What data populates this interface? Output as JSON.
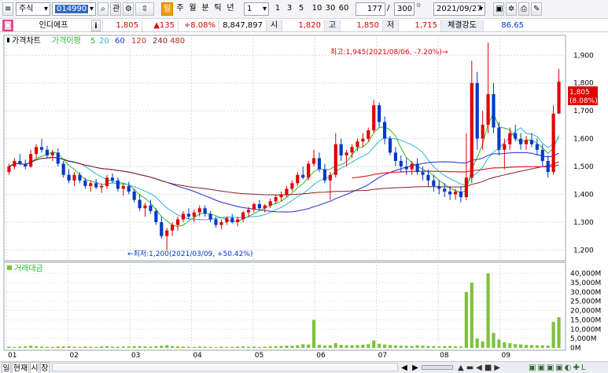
{
  "toolbar": {
    "market_select": "주식",
    "code_value": "014990",
    "buttons": {
      "gwan": "관",
      "daily": "일",
      "weekly": "주",
      "monthly": "월",
      "minute": "분",
      "tick": "틱",
      "yearly": "년",
      "period_select": "1",
      "p1": "1",
      "p3": "3",
      "p5": "5",
      "p10": "10",
      "p30": "30",
      "p60": "60"
    },
    "count_value": "177",
    "slash": "/",
    "total_value": "300",
    "date_value": "2021/09/27"
  },
  "quote": {
    "name": "인디에프",
    "info_button": "i",
    "price": "1,805",
    "change": "▲135",
    "change_pct": "+8.08%",
    "volume": "8,847,897",
    "open_label": "시",
    "open": "1,820",
    "high_label": "고",
    "high": "1,850",
    "low_label": "저",
    "low": "1,715",
    "strength_label": "체결강도",
    "strength": "86.65"
  },
  "colors": {
    "up": "#e00000",
    "down": "#0038c8",
    "ma5": "#2db82d",
    "ma20": "#2ab5d8",
    "ma60": "#1e2fd2",
    "ma120": "#e02020",
    "ma240": "#8a1e1e",
    "ma480": "#b03020",
    "volume": "#7cc23a"
  },
  "chart_data": {
    "type": "candlestick",
    "legend": {
      "price_chart": "가격차트",
      "envelope": "가격이평",
      "ma_periods": [
        "5",
        "20",
        "60",
        "120",
        "240",
        "480"
      ]
    },
    "x_ticks": [
      "01",
      "02",
      "03",
      "04",
      "05",
      "06",
      "07",
      "08",
      "09"
    ],
    "y_ticks": [
      "1,900",
      "1,800",
      "1,700",
      "1,600",
      "1,500",
      "1,400",
      "1,300",
      "1,200"
    ],
    "ylim": [
      1170,
      1960
    ],
    "current_price_tag": "1,805",
    "current_pct_tag": "(8.08%)",
    "annotation_high": "최고:1,945(2021/08/06, -7.20%)→",
    "annotation_low": "←최저:1,200(2021/03/09, +50.42%)",
    "volume_panel": {
      "title": "거래대금",
      "y_ticks": [
        "40,000M",
        "35,000M",
        "30,000M",
        "25,000M",
        "20,000M",
        "15,000M",
        "10,000M",
        "5,000M",
        "0M"
      ],
      "ylim": [
        0,
        43000
      ]
    },
    "candles": [
      [
        1480,
        1510,
        1470,
        1500
      ],
      [
        1500,
        1530,
        1490,
        1520
      ],
      [
        1520,
        1545,
        1505,
        1510
      ],
      [
        1510,
        1525,
        1490,
        1500
      ],
      [
        1500,
        1560,
        1495,
        1545
      ],
      [
        1545,
        1580,
        1530,
        1570
      ],
      [
        1570,
        1600,
        1550,
        1560
      ],
      [
        1560,
        1575,
        1530,
        1540
      ],
      [
        1540,
        1560,
        1520,
        1550
      ],
      [
        1550,
        1565,
        1500,
        1510
      ],
      [
        1510,
        1520,
        1460,
        1470
      ],
      [
        1470,
        1490,
        1440,
        1450
      ],
      [
        1450,
        1480,
        1430,
        1470
      ],
      [
        1470,
        1480,
        1440,
        1450
      ],
      [
        1450,
        1460,
        1420,
        1430
      ],
      [
        1430,
        1450,
        1410,
        1440
      ],
      [
        1440,
        1455,
        1420,
        1425
      ],
      [
        1425,
        1440,
        1405,
        1430
      ],
      [
        1430,
        1470,
        1420,
        1460
      ],
      [
        1460,
        1475,
        1440,
        1450
      ],
      [
        1450,
        1460,
        1410,
        1420
      ],
      [
        1420,
        1440,
        1395,
        1430
      ],
      [
        1430,
        1445,
        1400,
        1410
      ],
      [
        1410,
        1420,
        1370,
        1380
      ],
      [
        1380,
        1400,
        1340,
        1350
      ],
      [
        1350,
        1370,
        1320,
        1360
      ],
      [
        1360,
        1380,
        1330,
        1340
      ],
      [
        1340,
        1350,
        1290,
        1300
      ],
      [
        1300,
        1320,
        1240,
        1250
      ],
      [
        1250,
        1280,
        1200,
        1270
      ],
      [
        1270,
        1300,
        1250,
        1290
      ],
      [
        1290,
        1320,
        1270,
        1310
      ],
      [
        1310,
        1340,
        1300,
        1330
      ],
      [
        1330,
        1350,
        1310,
        1320
      ],
      [
        1320,
        1345,
        1300,
        1335
      ],
      [
        1335,
        1360,
        1320,
        1350
      ],
      [
        1350,
        1360,
        1320,
        1330
      ],
      [
        1330,
        1340,
        1300,
        1310
      ],
      [
        1310,
        1320,
        1280,
        1290
      ],
      [
        1290,
        1310,
        1275,
        1300
      ],
      [
        1300,
        1320,
        1290,
        1315
      ],
      [
        1315,
        1330,
        1295,
        1300
      ],
      [
        1300,
        1320,
        1285,
        1310
      ],
      [
        1310,
        1340,
        1300,
        1335
      ],
      [
        1335,
        1355,
        1320,
        1345
      ],
      [
        1345,
        1370,
        1335,
        1365
      ],
      [
        1365,
        1380,
        1345,
        1350
      ],
      [
        1350,
        1365,
        1335,
        1360
      ],
      [
        1360,
        1385,
        1350,
        1375
      ],
      [
        1375,
        1400,
        1365,
        1390
      ],
      [
        1390,
        1410,
        1375,
        1400
      ],
      [
        1400,
        1430,
        1390,
        1420
      ],
      [
        1420,
        1450,
        1410,
        1440
      ],
      [
        1440,
        1480,
        1430,
        1470
      ],
      [
        1470,
        1500,
        1455,
        1460
      ],
      [
        1460,
        1520,
        1450,
        1510
      ],
      [
        1510,
        1560,
        1500,
        1530
      ],
      [
        1530,
        1550,
        1480,
        1490
      ],
      [
        1490,
        1510,
        1440,
        1450
      ],
      [
        1450,
        1480,
        1380,
        1470
      ],
      [
        1470,
        1620,
        1460,
        1580
      ],
      [
        1580,
        1600,
        1520,
        1540
      ],
      [
        1540,
        1560,
        1500,
        1550
      ],
      [
        1550,
        1580,
        1530,
        1570
      ],
      [
        1570,
        1600,
        1555,
        1590
      ],
      [
        1590,
        1620,
        1570,
        1600
      ],
      [
        1600,
        1640,
        1590,
        1630
      ],
      [
        1630,
        1740,
        1620,
        1720
      ],
      [
        1720,
        1730,
        1640,
        1660
      ],
      [
        1660,
        1680,
        1580,
        1600
      ],
      [
        1600,
        1610,
        1540,
        1550
      ],
      [
        1550,
        1570,
        1500,
        1520
      ],
      [
        1520,
        1540,
        1480,
        1500
      ],
      [
        1500,
        1530,
        1470,
        1490
      ],
      [
        1490,
        1520,
        1470,
        1510
      ],
      [
        1510,
        1530,
        1470,
        1480
      ],
      [
        1480,
        1500,
        1450,
        1470
      ],
      [
        1470,
        1490,
        1430,
        1450
      ],
      [
        1450,
        1470,
        1410,
        1430
      ],
      [
        1430,
        1450,
        1400,
        1420
      ],
      [
        1420,
        1440,
        1390,
        1410
      ],
      [
        1410,
        1430,
        1380,
        1400
      ],
      [
        1400,
        1420,
        1380,
        1410
      ],
      [
        1410,
        1430,
        1370,
        1390
      ],
      [
        1390,
        1620,
        1380,
        1460
      ],
      [
        1460,
        1880,
        1440,
        1800
      ],
      [
        1800,
        1840,
        1560,
        1600
      ],
      [
        1600,
        1700,
        1560,
        1650
      ],
      [
        1650,
        1945,
        1620,
        1760
      ],
      [
        1760,
        1800,
        1620,
        1640
      ],
      [
        1640,
        1660,
        1540,
        1560
      ],
      [
        1560,
        1600,
        1490,
        1580
      ],
      [
        1580,
        1640,
        1560,
        1620
      ],
      [
        1620,
        1650,
        1590,
        1600
      ],
      [
        1600,
        1620,
        1560,
        1580
      ],
      [
        1580,
        1610,
        1560,
        1595
      ],
      [
        1595,
        1620,
        1570,
        1580
      ],
      [
        1580,
        1600,
        1540,
        1560
      ],
      [
        1560,
        1580,
        1500,
        1520
      ],
      [
        1520,
        1540,
        1460,
        1480
      ],
      [
        1480,
        1720,
        1470,
        1690
      ],
      [
        1690,
        1850,
        1715,
        1805
      ]
    ],
    "volumes": [
      600,
      500,
      700,
      800,
      1200,
      900,
      700,
      600,
      500,
      700,
      800,
      900,
      600,
      500,
      700,
      600,
      500,
      800,
      900,
      700,
      600,
      700,
      800,
      900,
      1000,
      800,
      700,
      900,
      1100,
      1500,
      900,
      800,
      700,
      600,
      500,
      700,
      600,
      500,
      400,
      600,
      500,
      600,
      700,
      800,
      600,
      700,
      500,
      600,
      800,
      900,
      1000,
      1200,
      1100,
      1400,
      2000,
      1800,
      15000,
      1700,
      1200,
      1400,
      2500,
      1600,
      1400,
      1300,
      1500,
      1700,
      2000,
      4000,
      2200,
      1800,
      1500,
      1300,
      1200,
      1100,
      1000,
      1400,
      1200,
      1000,
      900,
      800,
      900,
      1000,
      800,
      700,
      30000,
      35000,
      5000,
      3500,
      40000,
      8000,
      4500,
      3000,
      2500,
      2000,
      1800,
      1600,
      1500,
      1400,
      1300,
      1200,
      14000,
      16500
    ]
  },
  "bottom": {
    "tabs": [
      "일",
      "현재",
      "시",
      "장"
    ],
    "nav_buttons": [
      "◀",
      "▶"
    ]
  }
}
